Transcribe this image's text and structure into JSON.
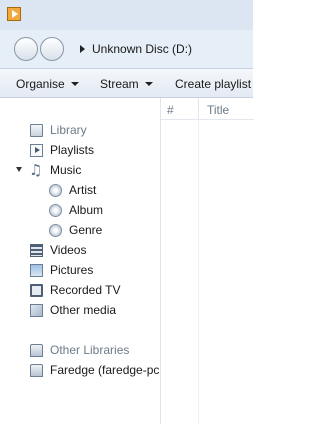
{
  "address": {
    "breadcrumb": "Unknown Disc (D:)"
  },
  "toolbar": {
    "organise": "Organise",
    "stream": "Stream",
    "create_playlist": "Create playlist"
  },
  "columns": {
    "number": "#",
    "title": "Title"
  },
  "nav": {
    "library": "Library",
    "playlists": "Playlists",
    "music": "Music",
    "artist": "Artist",
    "album": "Album",
    "genre": "Genre",
    "videos": "Videos",
    "pictures": "Pictures",
    "recorded_tv": "Recorded TV",
    "other_media": "Other media",
    "other_libraries": "Other Libraries",
    "faredge": "Faredge (faredge-pc"
  },
  "icons": {
    "app": "media-player-icon",
    "back": "back-icon",
    "forward": "forward-icon"
  }
}
